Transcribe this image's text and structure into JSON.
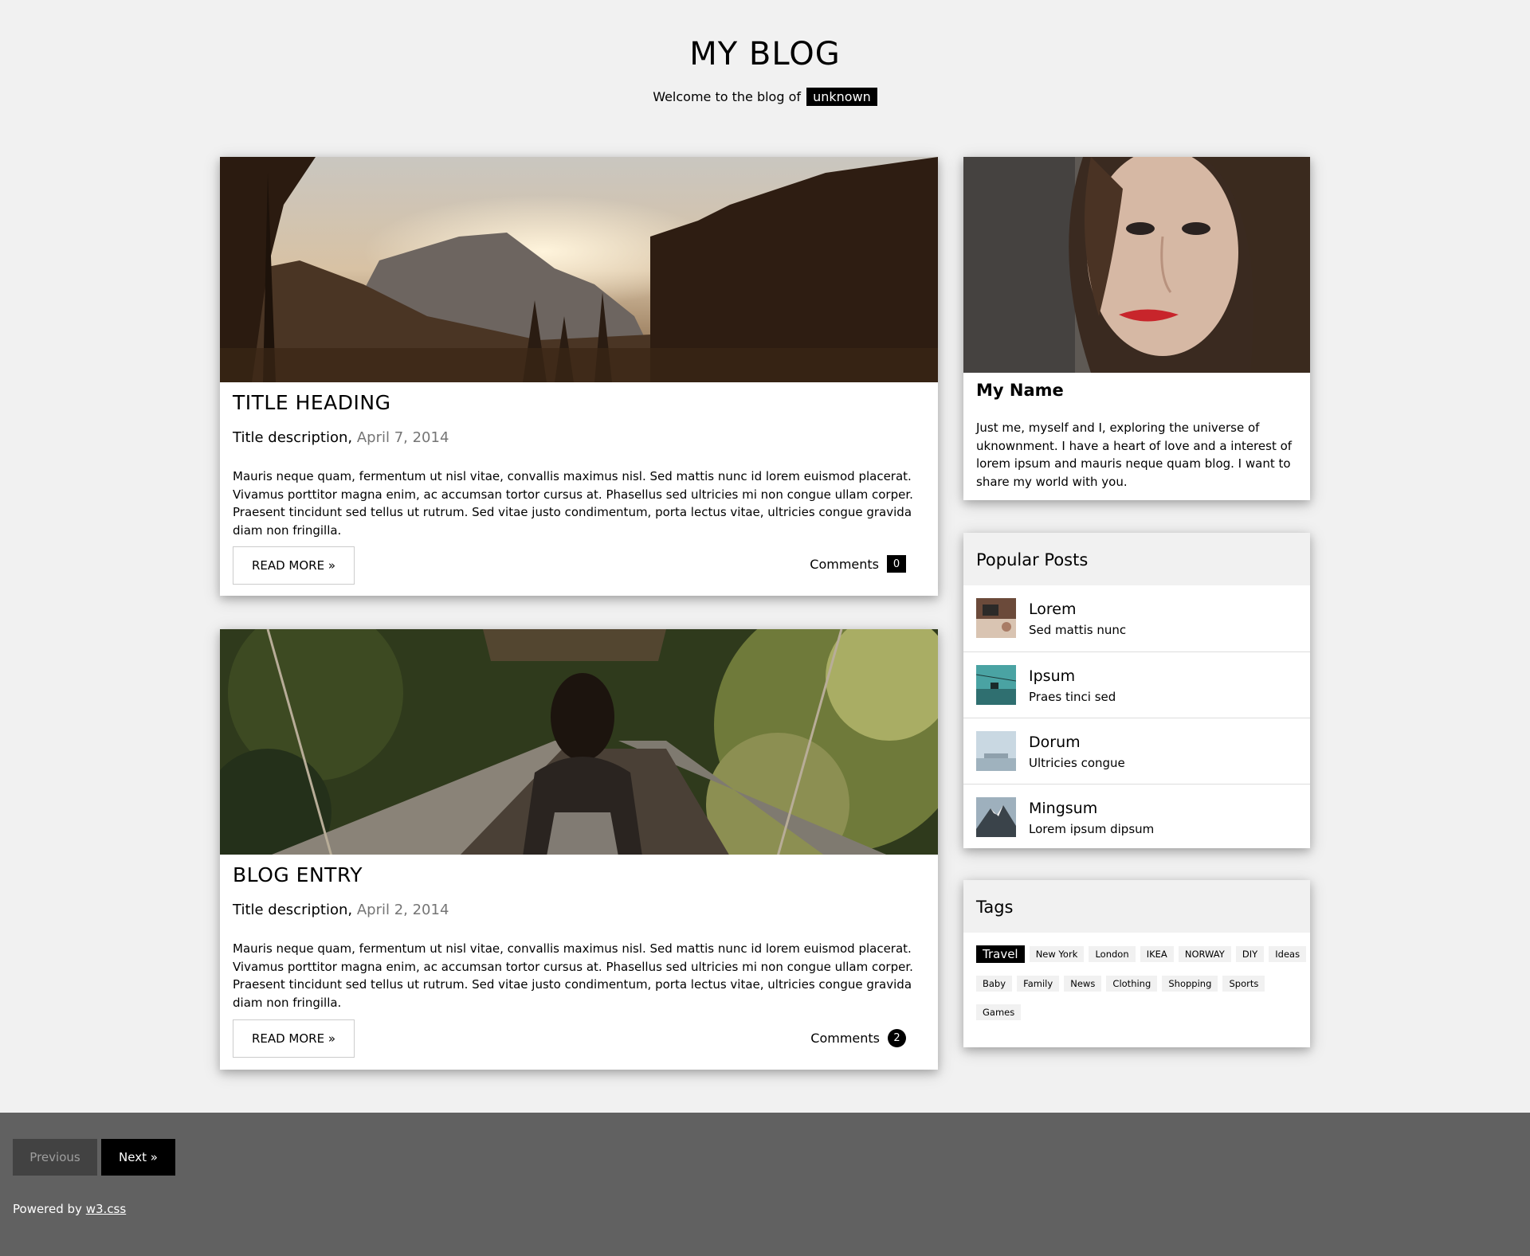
{
  "header": {
    "title": "MY BLOG",
    "subtitle_prefix": "Welcome to the blog of",
    "owner": "unknown"
  },
  "entries": [
    {
      "title": "TITLE HEADING",
      "description": "Title description,",
      "date": "April 7, 2014",
      "body": "Mauris neque quam, fermentum ut nisl vitae, convallis maximus nisl. Sed mattis nunc id lorem euismod placerat. Vivamus porttitor magna enim, ac accumsan tortor cursus at. Phasellus sed ultricies mi non congue ullam corper. Praesent tincidunt sed tellus ut rutrum. Sed vitae justo condimentum, porta lectus vitae, ultricies congue gravida diam non fringilla.",
      "read_more": "READ MORE »",
      "comments_label": "Comments",
      "comments_count": "0",
      "image": "mountain-sunset-photo"
    },
    {
      "title": "BLOG ENTRY",
      "description": "Title description,",
      "date": "April 2, 2014",
      "body": "Mauris neque quam, fermentum ut nisl vitae, convallis maximus nisl. Sed mattis nunc id lorem euismod placerat. Vivamus porttitor magna enim, ac accumsan tortor cursus at. Phasellus sed ultricies mi non congue ullam corper. Praesent tincidunt sed tellus ut rutrum. Sed vitae justo condimentum, porta lectus vitae, ultricies congue gravida diam non fringilla.",
      "read_more": "READ MORE »",
      "comments_label": "Comments",
      "comments_count": "2",
      "image": "woman-on-bridge-photo"
    }
  ],
  "profile": {
    "name": "My Name",
    "bio": "Just me, myself and I, exploring the universe of uknownment. I have a heart of love and a interest of lorem ipsum and mauris neque quam blog. I want to share my world with you.",
    "image": "portrait-photo"
  },
  "popular": {
    "heading": "Popular Posts",
    "items": [
      {
        "title": "Lorem",
        "subtitle": "Sed mattis nunc",
        "image": "workspace-thumbnail"
      },
      {
        "title": "Ipsum",
        "subtitle": "Praes tinci sed",
        "image": "gondola-thumbnail"
      },
      {
        "title": "Dorum",
        "subtitle": "Ultricies congue",
        "image": "skyline-thumbnail"
      },
      {
        "title": "Mingsum",
        "subtitle": "Lorem ipsum dipsum",
        "image": "mountain-thumbnail"
      }
    ]
  },
  "tags": {
    "heading": "Tags",
    "items": [
      "Travel",
      "New York",
      "London",
      "IKEA",
      "NORWAY",
      "DIY",
      "Ideas",
      "Baby",
      "Family",
      "News",
      "Clothing",
      "Shopping",
      "Sports",
      "Games"
    ],
    "active": "Travel"
  },
  "footer": {
    "previous": "Previous",
    "next": "Next »",
    "powered_prefix": "Powered by",
    "powered_link": "w3.css"
  },
  "colors": {
    "page_bg": "#f1f1f1",
    "footer_bg": "#616161",
    "accent": "#000000",
    "muted_text": "#757575"
  }
}
